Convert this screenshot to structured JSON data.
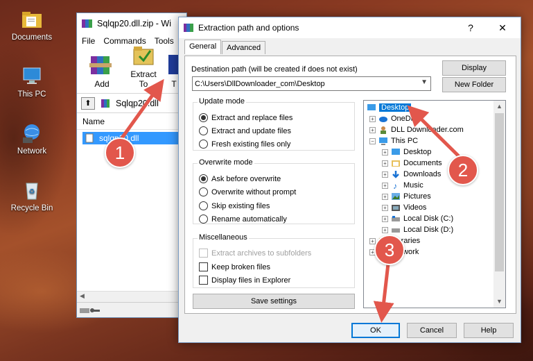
{
  "desktop": {
    "icons": [
      {
        "label": "Documents",
        "icon": "folder-documents-icon"
      },
      {
        "label": "This PC",
        "icon": "computer-icon"
      },
      {
        "label": "Network",
        "icon": "network-icon"
      },
      {
        "label": "Recycle Bin",
        "icon": "recycle-bin-icon"
      }
    ]
  },
  "winrar": {
    "title": "Sqlqp20.dll.zip - Wi",
    "menu": [
      "File",
      "Commands",
      "Tools"
    ],
    "toolbar": {
      "add": "Add",
      "extract_to": "Extract To",
      "third": "T"
    },
    "path": "Sqlqp20.dll",
    "column_name": "Name",
    "file": "sqlqp20.dll"
  },
  "dialog": {
    "title": "Extraction path and options",
    "help": "?",
    "close": "✕",
    "tabs": [
      "General",
      "Advanced"
    ],
    "dest_label": "Destination path (will be created if does not exist)",
    "dest_value": "C:\\Users\\DllDownloader_com\\Desktop",
    "display_btn": "Display",
    "new_folder_btn": "New Folder",
    "update_mode": {
      "title": "Update mode",
      "options": [
        "Extract and replace files",
        "Extract and update files",
        "Fresh existing files only"
      ],
      "selected": 0
    },
    "overwrite_mode": {
      "title": "Overwrite mode",
      "options": [
        "Ask before overwrite",
        "Overwrite without prompt",
        "Skip existing files",
        "Rename automatically"
      ],
      "selected": 0
    },
    "misc": {
      "title": "Miscellaneous",
      "options": [
        "Extract archives to subfolders",
        "Keep broken files",
        "Display files in Explorer"
      ]
    },
    "save_settings": "Save settings",
    "tree": [
      "Desktop",
      "OneDrive",
      "DLL Downloader.com",
      "This PC",
      "Desktop",
      "Documents",
      "Downloads",
      "Music",
      "Pictures",
      "Videos",
      "Local Disk (C:)",
      "Local Disk (D:)",
      "Libraries",
      "Network"
    ],
    "ok": "OK",
    "cancel": "Cancel",
    "help_btn": "Help"
  },
  "annotations": {
    "m1": "1",
    "m2": "2",
    "m3": "3",
    "color": "#e2574c"
  }
}
